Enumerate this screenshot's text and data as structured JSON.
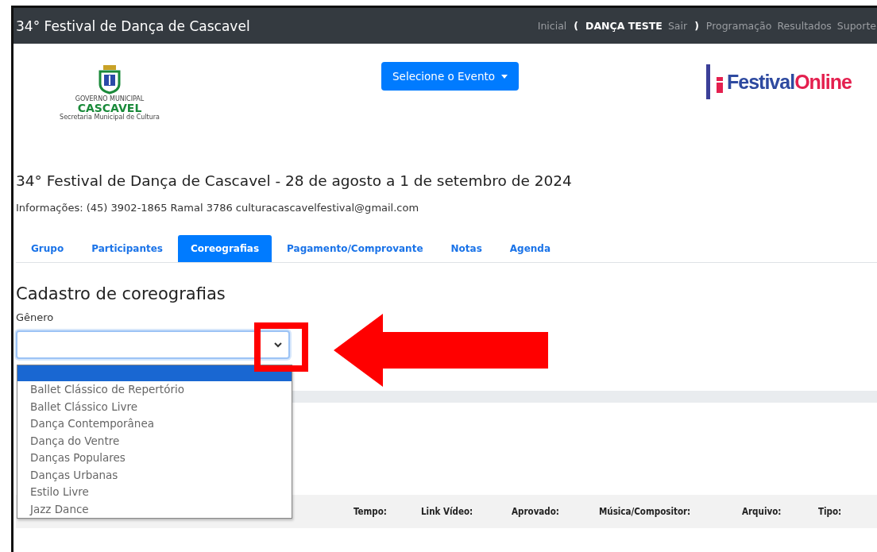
{
  "navbar": {
    "brand": "34° Festival de Dança de Cascavel",
    "links": [
      {
        "label": "Inicial",
        "kind": "link"
      },
      {
        "label": "(",
        "kind": "paren"
      },
      {
        "label": "DANÇA TESTE",
        "kind": "user"
      },
      {
        "label": "Sair",
        "kind": "link"
      },
      {
        "label": ")",
        "kind": "paren"
      },
      {
        "label": "Programação",
        "kind": "link"
      },
      {
        "label": "Resultados",
        "kind": "link"
      },
      {
        "label": "Suporte",
        "kind": "link"
      }
    ]
  },
  "city_logo": {
    "line_1": "GOVERNO MUNICIPAL",
    "line_2": "CASCAVEL",
    "line_3": "Secretaria Municipal de Cultura"
  },
  "event_button": {
    "label": "Selecione o Evento"
  },
  "brand_logo": {
    "part_1": "Festival",
    "part_2": "Online"
  },
  "title": "34° Festival de Dança de Cascavel - 28 de agosto a 1 de setembro de 2024",
  "info": "Informações: (45) 3902-1865 Ramal 3786 culturacascavelfestival@gmail.com",
  "tabs": [
    {
      "label": "Grupo",
      "selected": false
    },
    {
      "label": "Participantes",
      "selected": false
    },
    {
      "label": "Coreografias",
      "selected": true
    },
    {
      "label": "Pagamento/Comprovante",
      "selected": false
    },
    {
      "label": "Notas",
      "selected": false
    },
    {
      "label": "Agenda",
      "selected": false
    }
  ],
  "section_title": "Cadastro de coreografias",
  "genre": {
    "label": "Gênero",
    "expanded": true,
    "blank_option_highlighted": true,
    "options": [
      {
        "label": "Ballet Clássico de Repertório",
        "selected": false
      },
      {
        "label": "Ballet Clássico Livre",
        "selected": false
      },
      {
        "label": "Dança Contemporânea",
        "selected": false
      },
      {
        "label": "Dança do Ventre",
        "selected": false
      },
      {
        "label": "Danças Populares",
        "selected": false
      },
      {
        "label": "Danças Urbanas",
        "selected": false
      },
      {
        "label": "Estilo Livre",
        "selected": false
      },
      {
        "label": "Jazz Dance",
        "selected": false
      }
    ]
  },
  "table": {
    "columns": [
      "Tempo:",
      "Link Vídeo:",
      "Aprovado:",
      "Música/Compositor:",
      "Arquivo:",
      "Tipo:"
    ]
  }
}
